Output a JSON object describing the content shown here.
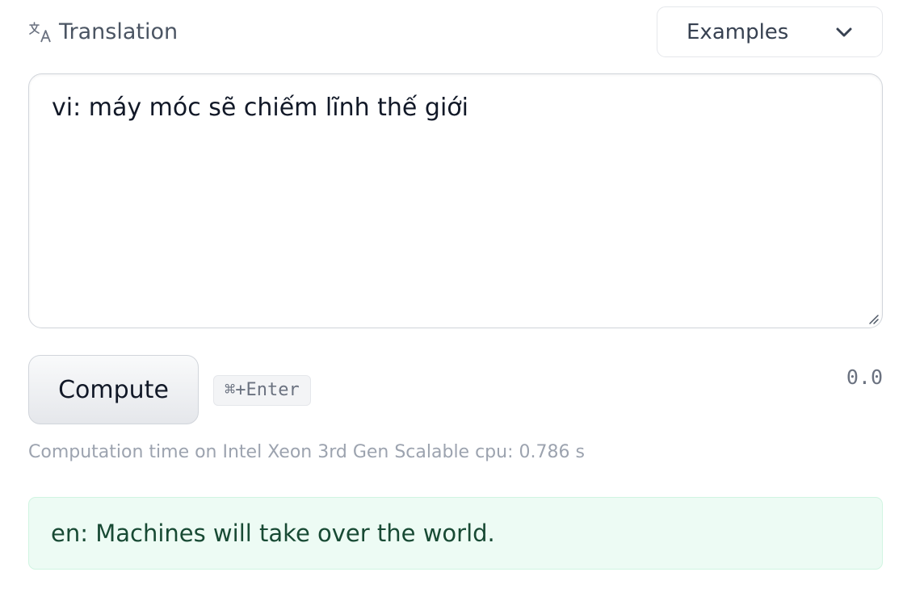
{
  "header": {
    "task_icon": "translate-icon",
    "task_label": "Translation",
    "examples_label": "Examples",
    "examples_icon": "chevron-down-icon"
  },
  "input": {
    "value": "vi: máy móc sẽ chiếm lĩnh thế giới"
  },
  "actions": {
    "compute_label": "Compute",
    "shortcut": "⌘+Enter",
    "score": "0.0"
  },
  "status": {
    "computation_time": "Computation time on Intel Xeon 3rd Gen Scalable cpu: 0.786 s"
  },
  "output": {
    "text": "en: Machines will take over the world."
  },
  "colors": {
    "output_background": "#edfbf4",
    "output_text": "#184a34",
    "muted_text": "#9ca3af"
  }
}
